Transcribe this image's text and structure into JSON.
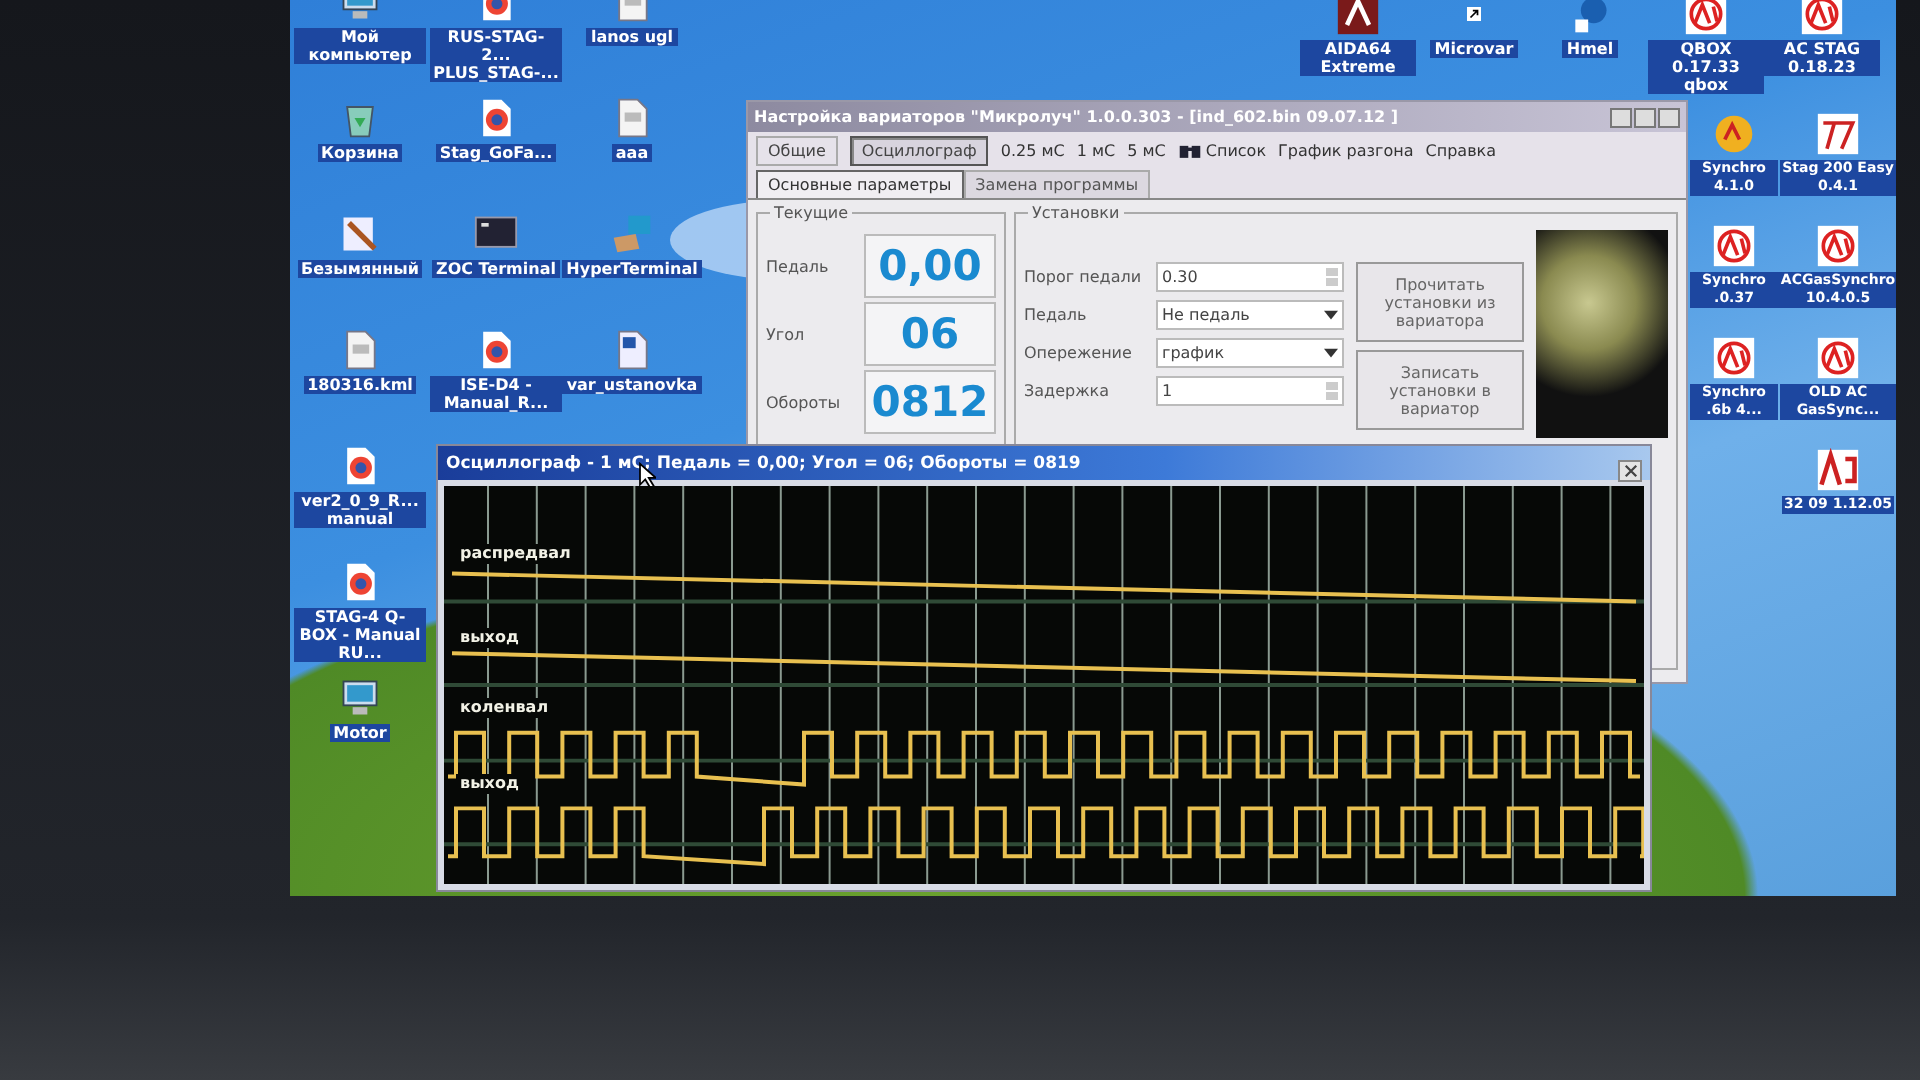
{
  "desktop": {
    "left_columns": [
      [
        {
          "label": "Мой компьютер",
          "kind": "computer"
        },
        {
          "label": "Корзина",
          "kind": "recycle"
        },
        {
          "label": "Безымянный",
          "kind": "paint"
        },
        {
          "label": "180316.kml",
          "kind": "document"
        },
        {
          "label": "ver2_0_9_R... manual",
          "kind": "browser"
        },
        {
          "label": "STAG-4 Q-BOX - Manual RU...",
          "kind": "browser"
        },
        {
          "label": "Motor",
          "kind": "computer"
        }
      ],
      [
        {
          "label": "RUS-STAG-2... PLUS_STAG-...",
          "kind": "browser"
        },
        {
          "label": "Stag_GoFa...",
          "kind": "browser"
        },
        {
          "label": "ZOC Terminal",
          "kind": "terminal"
        },
        {
          "label": "ISE-D4 - Manual_R...",
          "kind": "browser"
        }
      ],
      [
        {
          "label": "lanos ugl",
          "kind": "document"
        },
        {
          "label": "ааа",
          "kind": "document"
        },
        {
          "label": "HyperTerminal",
          "kind": "network"
        },
        {
          "label": "var_ustanovka",
          "kind": "word"
        }
      ]
    ],
    "top_row": [
      {
        "label": "AIDA64 Extreme",
        "kind": "red-tile"
      },
      {
        "label": "Microvar",
        "kind": "shortcut"
      },
      {
        "label": "Hmel",
        "kind": "network"
      },
      {
        "label": "QBOX 0.17.33 qbox",
        "kind": "ac"
      },
      {
        "label": "AC STAG 0.18.23",
        "kind": "ac"
      }
    ],
    "right_columns": [
      [
        {
          "label": "Synchro 4.1.0",
          "kind": "yellow-disc"
        },
        {
          "label": "Synchro .0.37",
          "kind": "ac"
        },
        {
          "label": "Synchro .6b 4...",
          "kind": "ac"
        }
      ],
      [
        {
          "label": "Stag 200 Easy 0.4.1",
          "kind": "tool"
        },
        {
          "label": "ACGasSynchro 10.4.0.5",
          "kind": "ac"
        },
        {
          "label": "OLD AC GasSync...",
          "kind": "ac"
        },
        {
          "label": "32 09 1.12.05",
          "kind": "ag"
        }
      ]
    ]
  },
  "main_window": {
    "title": "Настройка вариаторов \"Микролуч\" 1.0.0.303 - [ind_602.bin 09.07.12 ]",
    "menu": [
      {
        "label": "Общие",
        "kind": "button",
        "selected": false
      },
      {
        "label": "Осциллограф",
        "kind": "button",
        "selected": true
      },
      {
        "label": "0.25 мС",
        "kind": "text",
        "selected": false
      },
      {
        "label": "1 мС",
        "kind": "text",
        "selected": false
      },
      {
        "label": "5 мС",
        "kind": "text",
        "selected": false
      },
      {
        "label": "Список",
        "kind": "icon-text",
        "selected": false
      },
      {
        "label": "График разгона",
        "kind": "text",
        "selected": false
      },
      {
        "label": "Справка",
        "kind": "text",
        "selected": false
      }
    ],
    "tabs": [
      {
        "label": "Основные параметры",
        "selected": true
      },
      {
        "label": "Замена программы",
        "selected": false
      }
    ],
    "current": {
      "title": "Текущие",
      "readings": [
        {
          "label": "Педаль",
          "value": "0,00"
        },
        {
          "label": "Угол",
          "value": "06"
        },
        {
          "label": "Обороты",
          "value": "0812"
        }
      ]
    },
    "settings": {
      "title": "Установки",
      "fields": [
        {
          "label": "Порог педали",
          "value": "0.30",
          "kind": "spin"
        },
        {
          "label": "Педаль",
          "value": "Не педаль",
          "kind": "dropdown"
        },
        {
          "label": "Опережение",
          "value": "график",
          "kind": "dropdown"
        },
        {
          "label": "Задержка",
          "value": "1",
          "kind": "spin"
        }
      ],
      "buttons": [
        "Прочитать установки из вариатора",
        "Записать установки в вариатор"
      ]
    }
  },
  "osc_window": {
    "title": "Осциллограф - 1 мС; Педаль = 0,00; Угол = 06; Обороты = 0819",
    "channels": [
      {
        "label": "распредвал",
        "kind": "flat"
      },
      {
        "label": "выход",
        "kind": "flat"
      },
      {
        "label": "коленвал",
        "kind": "pulse"
      },
      {
        "label": "выход",
        "kind": "pulse"
      }
    ]
  }
}
